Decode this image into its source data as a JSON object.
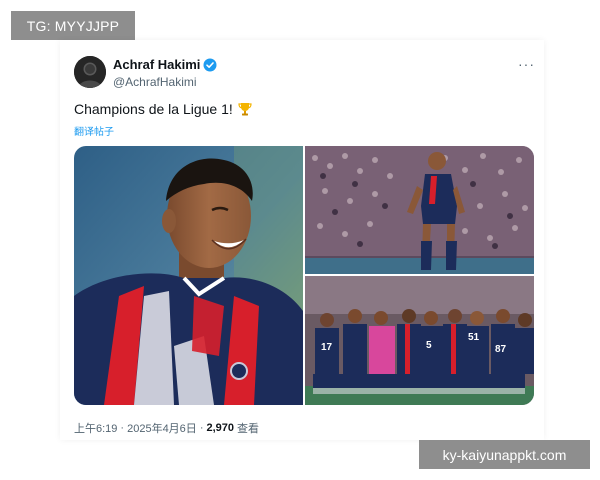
{
  "watermarks": {
    "top_left": "TG: MYYJJPP",
    "bottom_right": "ky-kaiyunappkt.com"
  },
  "tweet": {
    "author_name": "Achraf Hakimi",
    "author_handle": "@AchrafHakimi",
    "verified": true,
    "text": "Champions de la Ligue 1!",
    "emoji": "trophy-icon",
    "translate_label": "翻译帖子",
    "time": "上午6:19",
    "separator": "·",
    "date": "2025年4月6日",
    "views_count": "2,970",
    "views_label": "查看",
    "more_label": "···"
  },
  "media": [
    {
      "name": "hakimi-smiling-photo",
      "shirt_colors": [
        "#1c2c5a",
        "#d71f2b",
        "#ffffff"
      ]
    },
    {
      "name": "stadium-crowd-player-photo"
    },
    {
      "name": "team-huddle-photo",
      "shirt_numbers": [
        "17",
        "5",
        "51",
        "87"
      ]
    }
  ],
  "colors": {
    "accent": "#1d9bf0",
    "text": "#0f1419",
    "muted": "#536471",
    "watermark_bg": "#8e8e8e"
  }
}
